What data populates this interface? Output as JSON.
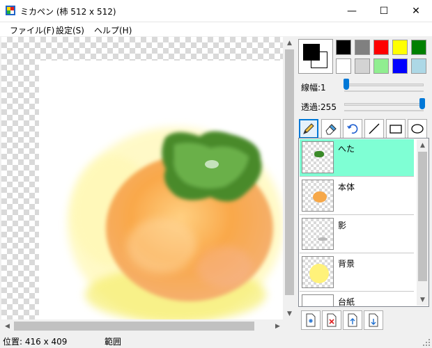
{
  "window": {
    "title": "ミカペン (柿 512 x 512)",
    "minimize_glyph": "—",
    "maximize_glyph": "☐",
    "close_glyph": "✕"
  },
  "menu": {
    "file": "ファイル(F)",
    "settings": "設定(S)",
    "help": "ヘルプ(H)"
  },
  "colors": {
    "foreground": "#000000",
    "background": "#ffffff",
    "palette": [
      "#000000",
      "#808080",
      "#ff0000",
      "#ffff00",
      "#008000",
      "#ffffff",
      "#d3d3d3",
      "#90ee90",
      "#0000ff",
      "#add8e6"
    ]
  },
  "brush": {
    "width_label": "線幅:1",
    "opacity_label": "透過:255",
    "width_value": 1,
    "opacity_value": 255
  },
  "tools": [
    "pencil-icon",
    "eraser-icon",
    "lasso-icon",
    "line-icon",
    "rectangle-icon",
    "ellipse-icon"
  ],
  "layers": [
    {
      "name": "へた",
      "selected": true
    },
    {
      "name": "本体",
      "selected": false
    },
    {
      "name": "影",
      "selected": false
    },
    {
      "name": "背景",
      "selected": false
    },
    {
      "name": "台紙",
      "selected": false
    }
  ],
  "status": {
    "position": "位置: 416  x  409",
    "range": "範囲"
  }
}
